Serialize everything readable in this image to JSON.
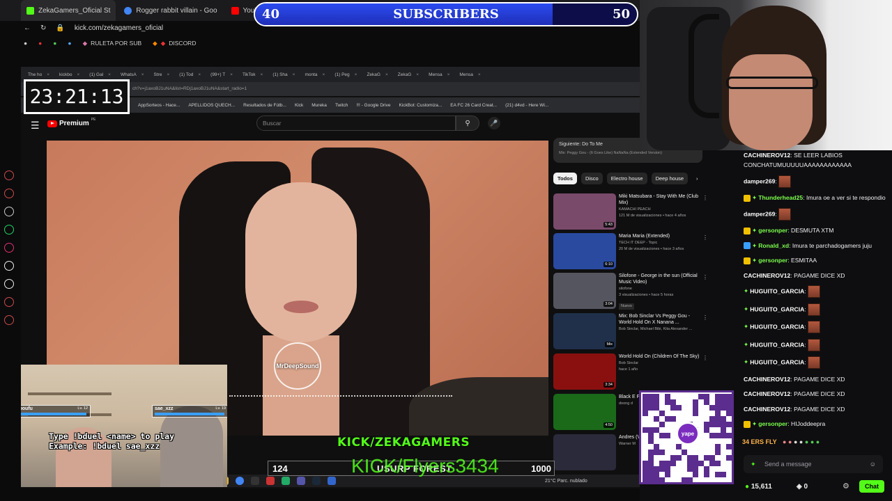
{
  "outer_browser": {
    "tabs": [
      {
        "label": "ZekaGamers_Oficial St",
        "color": "#53fc18"
      },
      {
        "label": "Rogger rabbit villain - Goo",
        "color": "#4285f4"
      },
      {
        "label": "YouTube",
        "color": "#ff0000"
      }
    ],
    "url": "kick.com/zekagamers_oficial",
    "bookmarks": [
      "RULETA POR SUB",
      "DISCORD"
    ]
  },
  "subscribers": {
    "start": "40",
    "label": "SUBSCRIBERS",
    "goal": "50",
    "progress": 0.78
  },
  "timer": "23:21:13",
  "inner_browser": {
    "tabs": [
      "The ho",
      "kickbo",
      "(1) Gal",
      "WhatsA",
      "Stre",
      "(1) Tod",
      "(99+) T",
      "TikTok",
      "(1) Sha",
      "monta",
      "(1) Peg",
      "ZekaG",
      "ZekaG",
      "Mensa",
      "Mensa"
    ],
    "url": "ch?v=j1axoBJ1uNA&list=RDj1axoBJ1uNA&start_radio=1",
    "bookmarks": [
      "AppSorteos - Hace...",
      "APELLIDOS QUECH...",
      "Resultados de Fútb...",
      "Kick",
      "Mureka",
      "Twitch",
      "!!! - Google Drive",
      "KickBot: Customiza...",
      "EA FC 26 Card Creat...",
      "(21) d4vd - Here Wi..."
    ]
  },
  "youtube": {
    "logo": "Premium",
    "region": "PE",
    "search_placeholder": "Buscar",
    "watermark": "MrDeepSound",
    "up_next": {
      "label": "Siguiente: Do To Me",
      "playlist": "Mix: Peggy Gou - (It Goes Like) NaNaNa (Extended Version)"
    },
    "chips": [
      "Todos",
      "Disco",
      "Electro house",
      "Deep house"
    ],
    "recommendations": [
      {
        "title": "Miki Matsubara - Stay With Me (Club Mix)",
        "channel": "KAMACHI PEACH",
        "meta": "121 M de visualizaciones • hace 4 años",
        "duration": "5:43",
        "color": "#7a4a6a"
      },
      {
        "title": "Maria Maria (Extended)",
        "channel": "TECH IT DEEP - Topic",
        "meta": "20 M de visualizaciones • hace 3 años",
        "duration": "6:10",
        "color": "#2a4aa0"
      },
      {
        "title": "Silofone - George in the sun (Official Music Video)",
        "channel": "silofone",
        "meta": "3 visualizaciones • hace 5 horas",
        "extra": "Nuevo",
        "duration": "3:04",
        "color": "#555560"
      },
      {
        "title": "Mix: Bob Sinclar Vs Peggy Gou - World Hold On X Nanana ...",
        "channel": "Bob Sinclar, Michael Bibi, Kita Alexander ...",
        "meta": "",
        "duration": "Mix",
        "color": "#20304a"
      },
      {
        "title": "World Hold On (Children Of The Sky)",
        "channel": "Bob Sinclar",
        "meta": "hace 1 año",
        "duration": "3:34",
        "color": "#8a1010"
      },
      {
        "title": "Black E Feeling",
        "channel": "doong d",
        "meta": "",
        "duration": "4:50",
        "color": "#1a6a1a"
      },
      {
        "title": "Andres (Video",
        "channel": "Warner M",
        "meta": "",
        "duration": "",
        "color": "#2a2a3a"
      }
    ]
  },
  "cam2": {
    "player1": {
      "name": "zpoufu",
      "level": "Lv. 12"
    },
    "player2": {
      "name": "sae_xzz",
      "level": "Lv. 19"
    },
    "line1": "Type !bduel <name> to play",
    "line2": "Example: !bduel sae_xzz"
  },
  "overlay_kick": "KICK/ZEKAGAMERS",
  "overlay_flyers": "KICK/Flyers3434",
  "goal": {
    "current": "124",
    "title": "USURP FOREST",
    "target": "1000"
  },
  "qr": {
    "brand": "yape"
  },
  "inner_taskbar": {
    "weather": "21°C Parc. nublado"
  },
  "chat": {
    "messages": [
      {
        "user": "CACHINEROV12",
        "color": "#ffffff",
        "text": "SE LEER LABIOS CONCHATUMUUUUUAAAAAAAAAAAA"
      },
      {
        "user": "damper269",
        "color": "#ffffff",
        "text": "",
        "emote": true
      },
      {
        "user": "Thunderhead25",
        "color": "#7cff4d",
        "text": "Imura oe a ver si te respondio",
        "badge": "#f0c000"
      },
      {
        "user": "damper269",
        "color": "#ffffff",
        "text": "",
        "emote": true
      },
      {
        "user": "gersonper",
        "color": "#7cff4d",
        "text": "DESMUTA XTM",
        "badge": "#f0c000"
      },
      {
        "user": "Ronald_xd",
        "color": "#7cff4d",
        "text": "Imura te parchadogamers juju",
        "badge": "#3aa0ff"
      },
      {
        "user": "gersonper",
        "color": "#7cff4d",
        "text": "ESMITAA",
        "badge": "#f0c000"
      },
      {
        "user": "CACHINEROV12",
        "color": "#ffffff",
        "text": "PAGAME DICE XD"
      },
      {
        "user": "HUGUITO_GARCIA",
        "color": "#ffffff",
        "text": "",
        "emote": true,
        "star": true
      },
      {
        "user": "HUGUITO_GARCIA",
        "color": "#ffffff",
        "text": "",
        "emote": true,
        "star": true
      },
      {
        "user": "HUGUITO_GARCIA",
        "color": "#ffffff",
        "text": "",
        "emote": true,
        "star": true
      },
      {
        "user": "HUGUITO_GARCIA",
        "color": "#ffffff",
        "text": "",
        "emote": true,
        "star": true
      },
      {
        "user": "HUGUITO_GARCIA",
        "color": "#ffffff",
        "text": "",
        "emote": true,
        "star": true
      },
      {
        "user": "CACHINEROV12",
        "color": "#ffffff",
        "text": "PAGAME DICE XD"
      },
      {
        "user": "CACHINEROV12",
        "color": "#ffffff",
        "text": "PAGAME DICE XD"
      },
      {
        "user": "CACHINEROV12",
        "color": "#ffffff",
        "text": "PAGAME DICE XD"
      },
      {
        "user": "gersonper",
        "color": "#7cff4d",
        "text": "HIJoddeepra",
        "badge": "#f0c000"
      }
    ],
    "emote_bar_text": "34 ERS FLY",
    "input_placeholder": "Send a message",
    "viewers": "15,611",
    "zero": "0",
    "chat_button": "Chat"
  }
}
